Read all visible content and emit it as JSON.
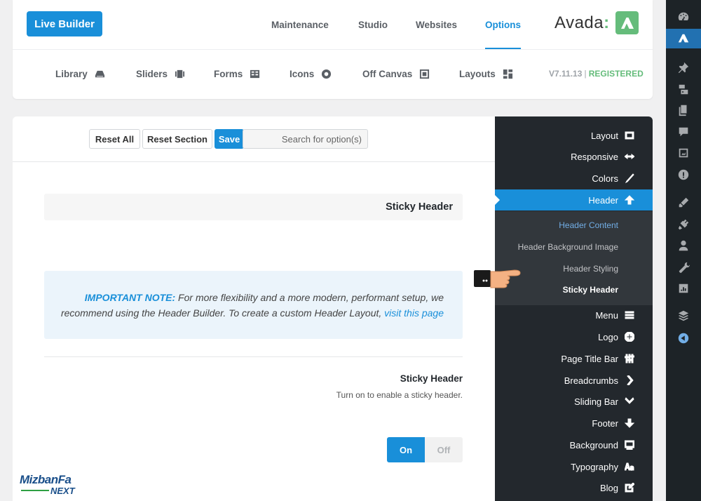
{
  "header": {
    "live_builder": "Live Builder",
    "nav": [
      "Maintenance",
      "Studio",
      "Websites",
      "Options"
    ],
    "active_nav": "Options",
    "brand": "Avada",
    "brand_colon": ":",
    "subnav": [
      {
        "label": "Library",
        "icon": "library-icon"
      },
      {
        "label": "Sliders",
        "icon": "sliders-icon"
      },
      {
        "label": "Forms",
        "icon": "forms-icon"
      },
      {
        "label": "Icons",
        "icon": "icons-icon"
      },
      {
        "label": "Off Canvas",
        "icon": "off-canvas-icon"
      },
      {
        "label": "Layouts",
        "icon": "layouts-icon"
      }
    ],
    "version": "V7.11.13",
    "version_sep": "|",
    "registered": "REGISTERED"
  },
  "toolbar": {
    "reset_all": "Reset All",
    "reset_section": "Reset Section",
    "save": "Save",
    "search_placeholder": "Search for option(s)"
  },
  "content": {
    "section_title": "Sticky Header",
    "note_label": "IMPORTANT NOTE:",
    "note_text": " For more flexibility and a more modern, performant setup, we recommend using the Header Builder. To create a custom Header Layout, ",
    "note_link": "visit this page",
    "option_title": "Sticky Header",
    "option_desc": "Turn on to enable a sticky header.",
    "toggle_on": "On",
    "toggle_off": "Off",
    "toggle_state": "on"
  },
  "menu": {
    "items": [
      {
        "label": "Layout",
        "icon": "layout-icon"
      },
      {
        "label": "Responsive",
        "icon": "responsive-icon"
      },
      {
        "label": "Colors",
        "icon": "colors-icon"
      },
      {
        "label": "Header",
        "icon": "header-icon"
      },
      {
        "label": "Menu",
        "icon": "menu-icon"
      },
      {
        "label": "Logo",
        "icon": "logo-icon"
      },
      {
        "label": "Page Title Bar",
        "icon": "page-title-bar-icon"
      },
      {
        "label": "Breadcrumbs",
        "icon": "breadcrumbs-icon"
      },
      {
        "label": "Sliding Bar",
        "icon": "sliding-bar-icon"
      },
      {
        "label": "Footer",
        "icon": "footer-icon"
      },
      {
        "label": "Background",
        "icon": "background-icon"
      },
      {
        "label": "Typography",
        "icon": "typography-icon"
      },
      {
        "label": "Blog",
        "icon": "blog-icon"
      }
    ],
    "active": "Header",
    "sub_items": [
      "Header Content",
      "Header Background Image",
      "Header Styling",
      "Sticky Header"
    ],
    "sub_current": "Header Content",
    "sub_selected": "Sticky Header"
  },
  "watermark": {
    "top": "MizbanFa",
    "bottom": "NEXT"
  },
  "colors": {
    "accent": "#198fd9",
    "registered": "#65bc7b",
    "menu_bg": "#23282d",
    "sub_bg": "#32373c"
  }
}
